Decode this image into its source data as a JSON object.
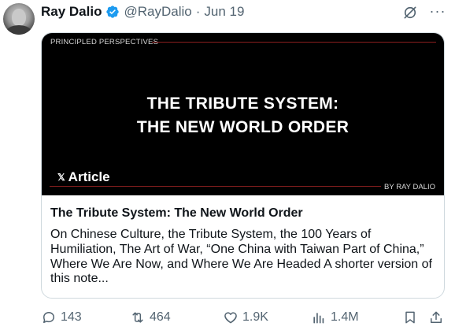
{
  "tweet": {
    "display_name": "Ray Dalio",
    "handle": "@RayDalio",
    "separator": "·",
    "date": "Jun 19",
    "more_label": "···"
  },
  "article_card": {
    "kicker": "PRINCIPLED PERSPECTIVES",
    "cover_title_line1": "THE TRIBUTE SYSTEM:",
    "cover_title_line2": "THE NEW WORLD ORDER",
    "badge_logo": "𝕏",
    "badge_label": "Article",
    "byline": "BY RAY DALIO",
    "title": "The Tribute System: The New World Order",
    "description": "On Chinese Culture, the Tribute System, the 100 Years of Humiliation, The Art of War, “One China with Taiwan Part of China,” Where We Are Now, and Where We Are Headed A shorter version of this note..."
  },
  "actions": {
    "replies": "143",
    "reposts": "464",
    "likes": "1.9K",
    "views": "1.4M"
  },
  "colors": {
    "verified_badge": "#1d9bf0",
    "secondary_text": "#536471",
    "cover_background": "#000000",
    "cover_rule": "#8a1f1f"
  }
}
